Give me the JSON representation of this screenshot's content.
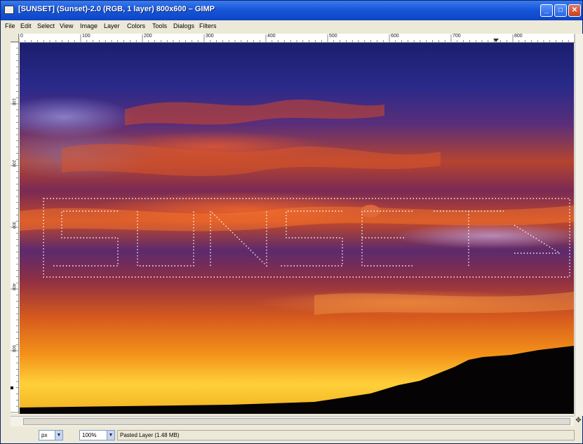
{
  "window": {
    "title": "[SUNSET] (Sunset)-2.0 (RGB, 1 layer) 800x600 – GIMP",
    "buttons": {
      "minimize": "_",
      "maximize": "□",
      "close": "✕"
    }
  },
  "menubar": {
    "items": [
      "File",
      "Edit",
      "Select",
      "View",
      "Image",
      "Layer",
      "Colors",
      "Tools",
      "Dialogs",
      "Filters"
    ]
  },
  "ruler": {
    "top_labels": [
      "0",
      "100",
      "200",
      "300",
      "400",
      "500",
      "600",
      "700",
      "800"
    ],
    "left_labels": [
      "100",
      "200",
      "300",
      "400",
      "500"
    ]
  },
  "canvas": {
    "selection_text": "SUNSET",
    "colors": {
      "sky_top": "#1b1f6e",
      "cloud_red": "#c2492a",
      "horizon": "#ffd03a",
      "silhouette": "#050303",
      "selection_marquee": "#ffffff"
    }
  },
  "statusbar": {
    "unit": "px",
    "zoom": "100%",
    "layer_info": "Pasted Layer (1.48 MB)"
  },
  "icons": {
    "app": "gimp-icon",
    "dropdown": "chevron-down-icon",
    "navigate": "navigate-icon"
  }
}
